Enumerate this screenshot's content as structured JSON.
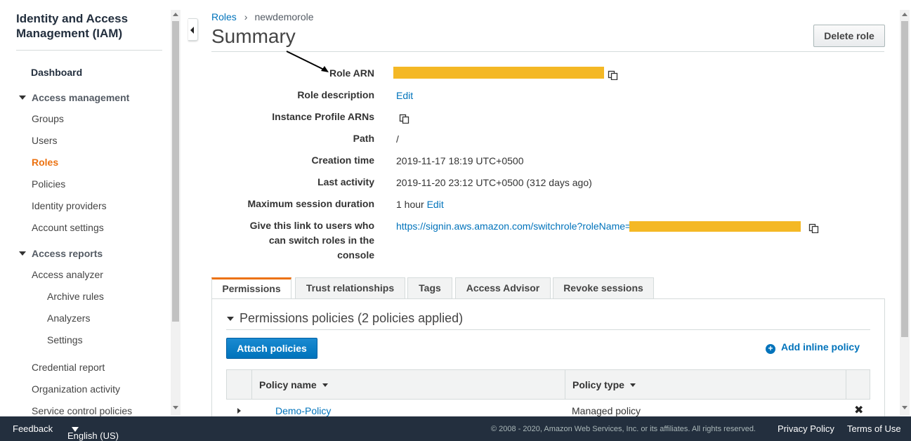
{
  "sidebar": {
    "title": "Identity and Access Management (IAM)",
    "dashboard": "Dashboard",
    "access_management": {
      "label": "Access management",
      "items": [
        "Groups",
        "Users",
        "Roles",
        "Policies",
        "Identity providers",
        "Account settings"
      ]
    },
    "access_reports": {
      "label": "Access reports",
      "analyzer": "Access analyzer",
      "sub_items": [
        "Archive rules",
        "Analyzers",
        "Settings"
      ],
      "items": [
        "Credential report",
        "Organization activity",
        "Service control policies"
      ]
    },
    "active_item": "Roles"
  },
  "breadcrumb": {
    "parent": "Roles",
    "current": "newdemorole"
  },
  "page_title": "Summary",
  "delete_button": "Delete role",
  "summary": {
    "role_arn_label": "Role ARN",
    "role_description_label": "Role description",
    "role_description_value": "Edit",
    "instance_profile_label": "Instance Profile ARNs",
    "path_label": "Path",
    "path_value": "/",
    "creation_time_label": "Creation time",
    "creation_time_value": "2019-11-17 18:19 UTC+0500",
    "last_activity_label": "Last activity",
    "last_activity_value": "2019-11-20 23:12 UTC+0500 (312 days ago)",
    "max_session_label": "Maximum session duration",
    "max_session_value": "1 hour",
    "max_session_edit": "Edit",
    "switch_link_label_1": "Give this link to users who",
    "switch_link_label_2": "can switch roles in the",
    "switch_link_label_3": "console",
    "switch_link_value": "https://signin.aws.amazon.com/switchrole?roleName="
  },
  "tabs": [
    "Permissions",
    "Trust relationships",
    "Tags",
    "Access Advisor",
    "Revoke sessions"
  ],
  "permissions": {
    "title": "Permissions policies (2 policies applied)",
    "attach_button": "Attach policies",
    "add_inline": "Add inline policy",
    "columns": [
      "Policy name",
      "Policy type"
    ],
    "rows": [
      {
        "name": "Demo-Policy",
        "type": "Managed policy"
      }
    ]
  },
  "footer": {
    "feedback": "Feedback",
    "language": "English (US)",
    "copyright": "© 2008 - 2020, Amazon Web Services, Inc. or its affiliates. All rights reserved.",
    "privacy": "Privacy Policy",
    "terms": "Terms of Use"
  },
  "colors": {
    "accent": "#ec7211",
    "link": "#0073bb",
    "redaction": "#f4b825",
    "footer_bg": "#232f3e"
  }
}
